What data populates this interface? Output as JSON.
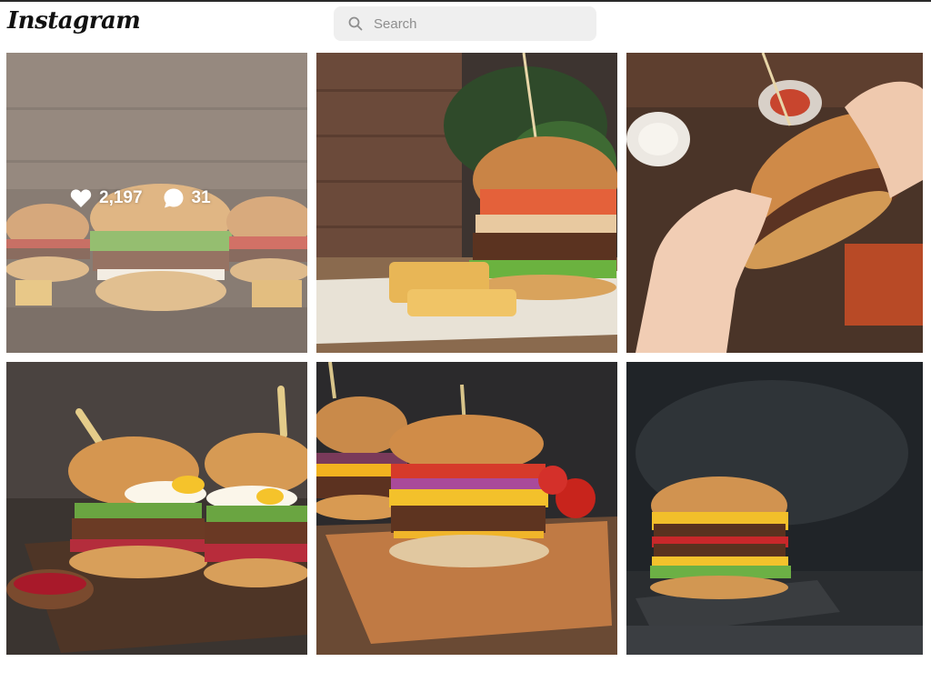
{
  "header": {
    "logo": "Instagram",
    "search": {
      "placeholder": "Search",
      "value": ""
    }
  },
  "posts": [
    {
      "id": 1,
      "hover": true,
      "likes": "2,197",
      "comments": "31"
    },
    {
      "id": 2,
      "hover": false
    },
    {
      "id": 3,
      "hover": false
    },
    {
      "id": 4,
      "hover": false
    },
    {
      "id": 5,
      "hover": false
    },
    {
      "id": 6,
      "hover": false
    }
  ],
  "icons": {
    "search": "search-icon",
    "like": "heart-icon",
    "comment": "comment-bubble-icon"
  },
  "colors": {
    "page_bg": "#ffffff",
    "search_bg": "#efefef",
    "overlay_text": "#ffffff"
  }
}
